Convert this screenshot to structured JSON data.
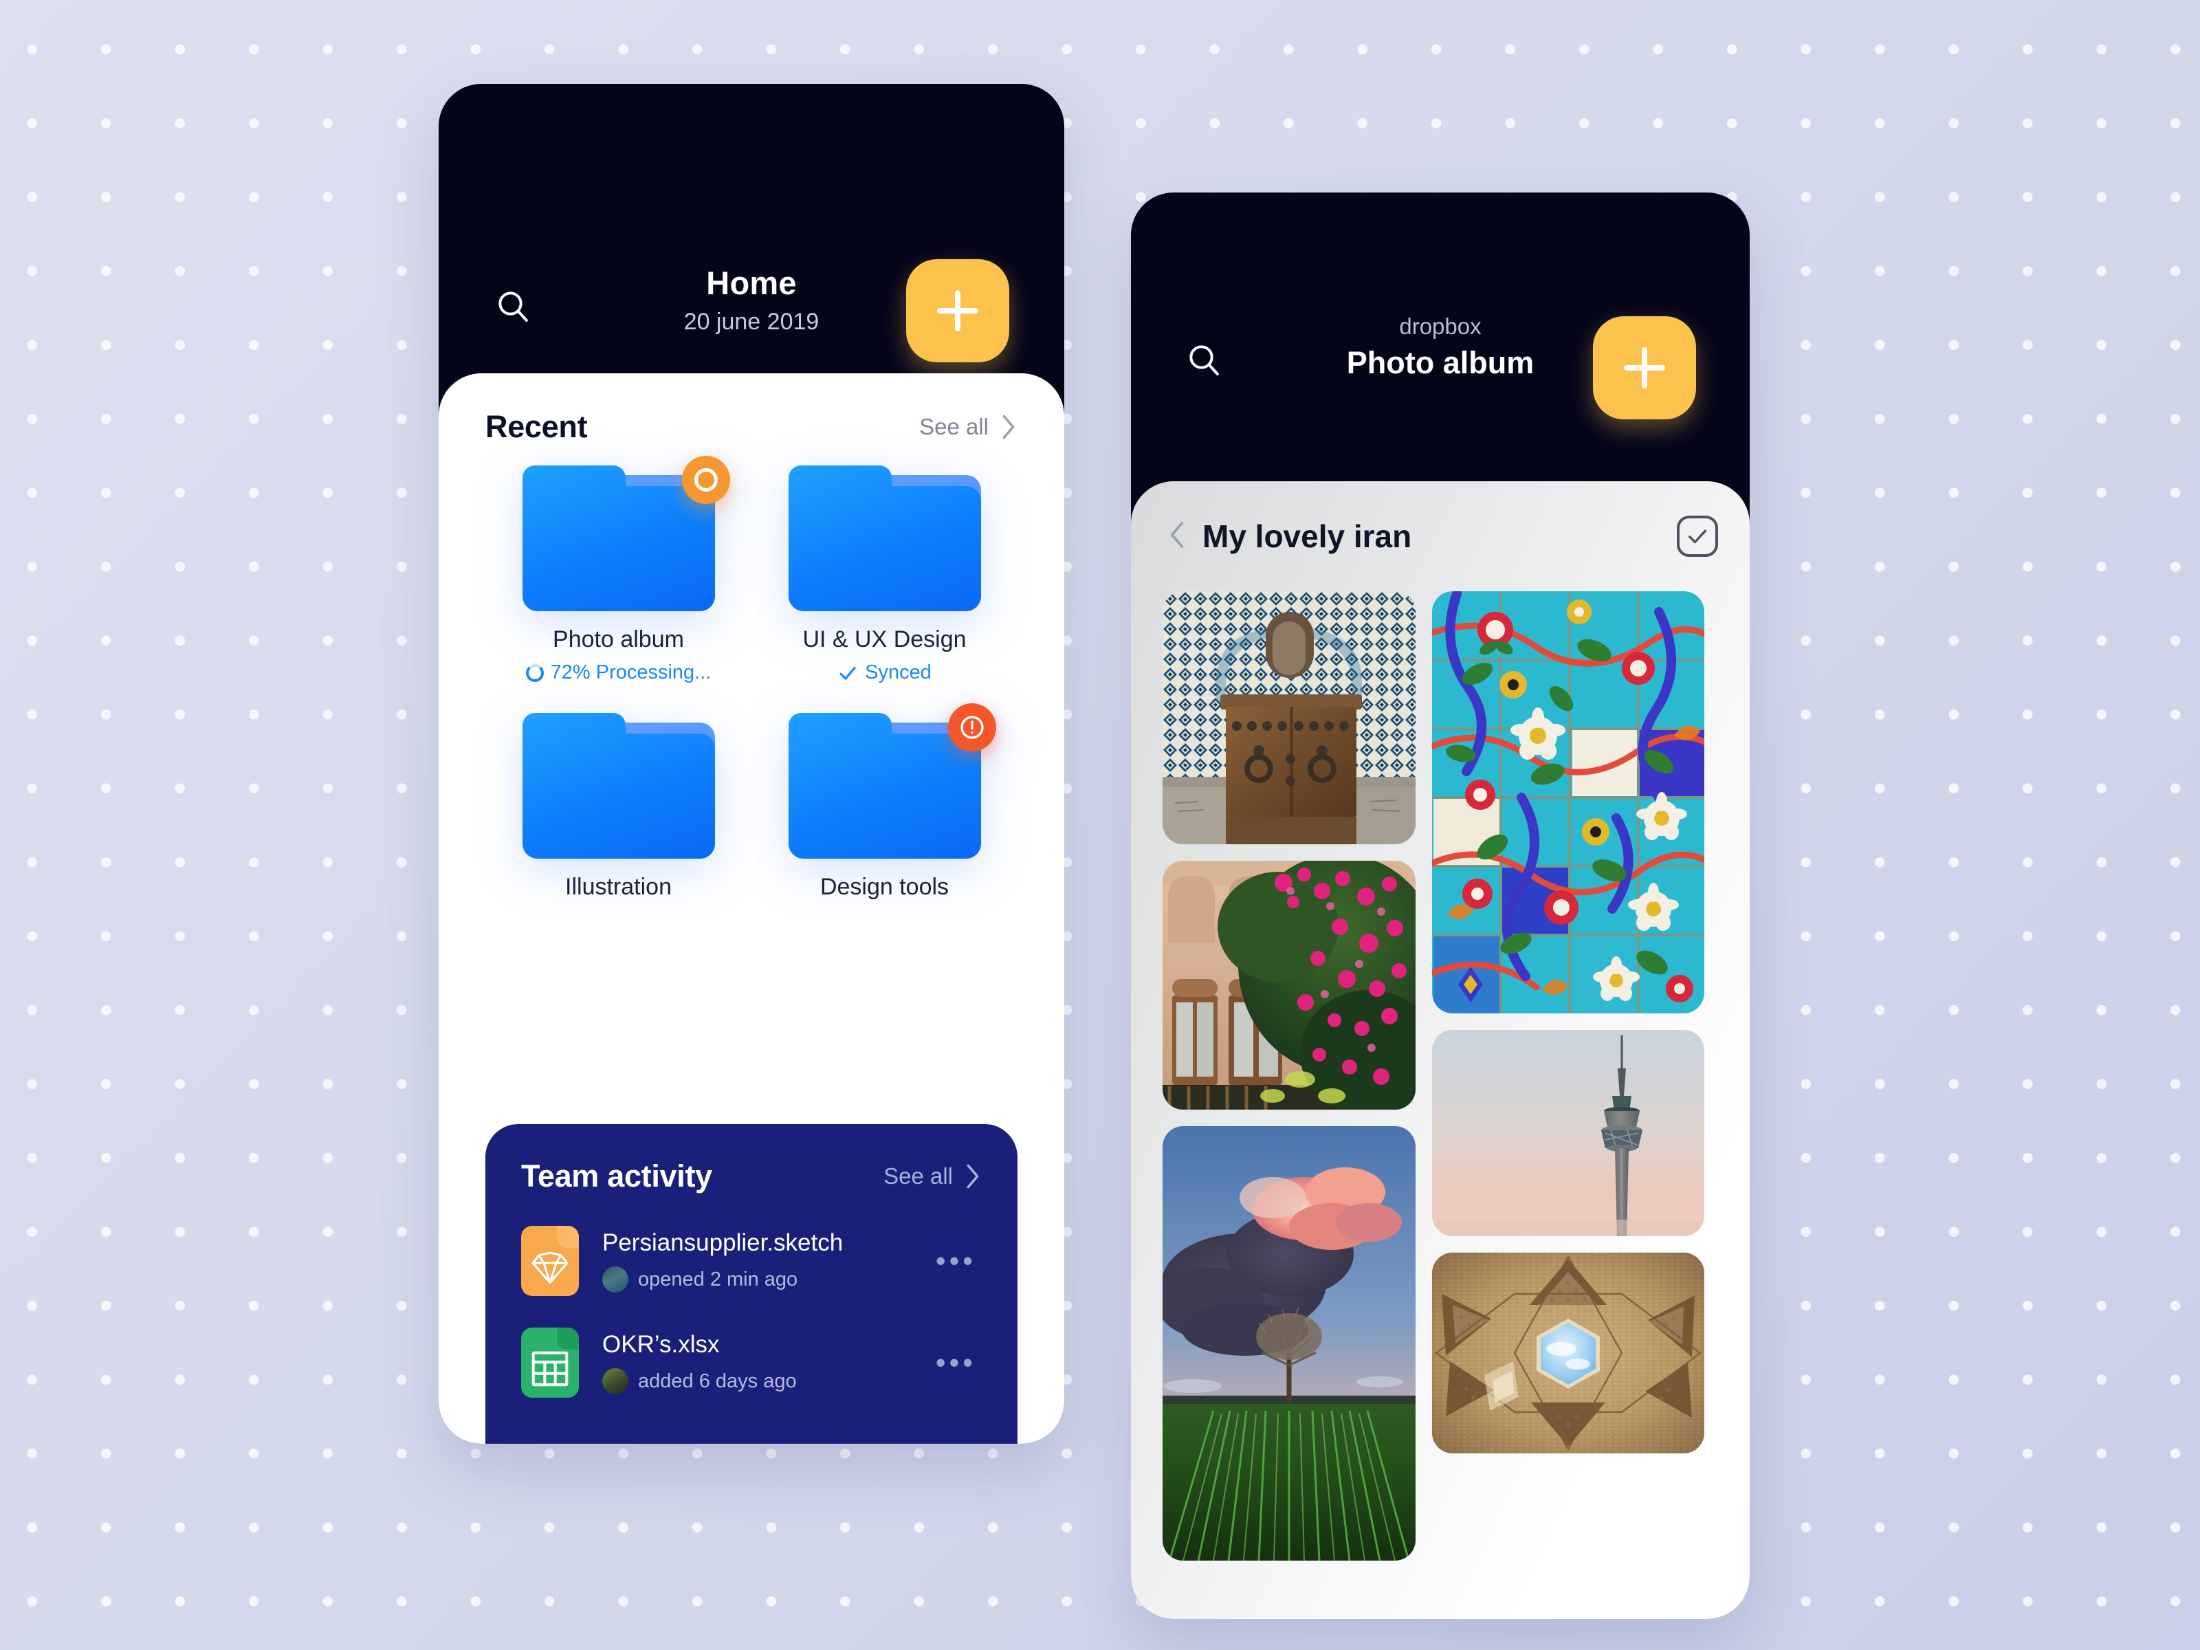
{
  "theme": {
    "accent_amber": "#FBC24C",
    "accent_blue": "#0D7CFB",
    "deep_navy": "#1A1F7A",
    "dark_header": "#05051A",
    "alert_red": "#F4572C",
    "processing_orange": "#F59833",
    "sketch_orange": "#F7A94C",
    "xlsx_green": "#2AB26A",
    "background": "#D5D9EC"
  },
  "left_phone": {
    "header": {
      "search_icon": "search-icon",
      "title": "Home",
      "date": "20 june 2019",
      "add_button_icon": "plus-icon"
    },
    "recent": {
      "title": "Recent",
      "see_all": "See all",
      "chevron_icon": "chevron-right-icon",
      "folders": [
        {
          "name": "Photo album",
          "status": "72% Processing...",
          "status_type": "processing",
          "status_icon": "spinner-icon",
          "badge": "processing",
          "badge_icon": "ring-icon"
        },
        {
          "name": "UI & UX Design",
          "status": "Synced",
          "status_type": "synced",
          "status_icon": "check-icon",
          "badge": "none"
        },
        {
          "name": "Illustration",
          "status": "",
          "status_type": "none",
          "badge": "none"
        },
        {
          "name": "Design tools",
          "status": "",
          "status_type": "none",
          "badge": "alert",
          "badge_icon": "exclamation-icon"
        }
      ]
    },
    "team_activity": {
      "title": "Team activity",
      "see_all": "See all",
      "chevron_icon": "chevron-right-icon",
      "items": [
        {
          "file_name": "Persiansupplier.sketch",
          "file_type": "sketch",
          "file_icon": "sketch-diamond-icon",
          "meta": "opened 2 min ago",
          "avatar": "user-avatar",
          "menu_icon": "more-horizontal-icon",
          "menu_label": "•••"
        },
        {
          "file_name": "OKR’s.xlsx",
          "file_type": "xlsx",
          "file_icon": "spreadsheet-grid-icon",
          "meta": "added 6 days ago",
          "avatar": "user-avatar",
          "menu_icon": "more-horizontal-icon",
          "menu_label": "•••"
        }
      ]
    }
  },
  "right_phone": {
    "header": {
      "search_icon": "search-icon",
      "eyebrow": "dropbox",
      "title": "Photo album",
      "add_button_icon": "plus-icon"
    },
    "album": {
      "back_icon": "chevron-left-icon",
      "title": "My lovely iran",
      "select_icon": "check-square-icon"
    },
    "photos": [
      {
        "alt": "persian-tiled-wooden-door",
        "column": "left"
      },
      {
        "alt": "traditional-house-with-bougainvillea",
        "column": "left"
      },
      {
        "alt": "lone-tree-in-green-field-at-dusk",
        "column": "left"
      },
      {
        "alt": "blue-floral-persian-tilework",
        "column": "right"
      },
      {
        "alt": "milad-tower-tehran",
        "column": "right"
      },
      {
        "alt": "brick-dome-ceiling-with-skylight",
        "column": "right"
      }
    ]
  }
}
